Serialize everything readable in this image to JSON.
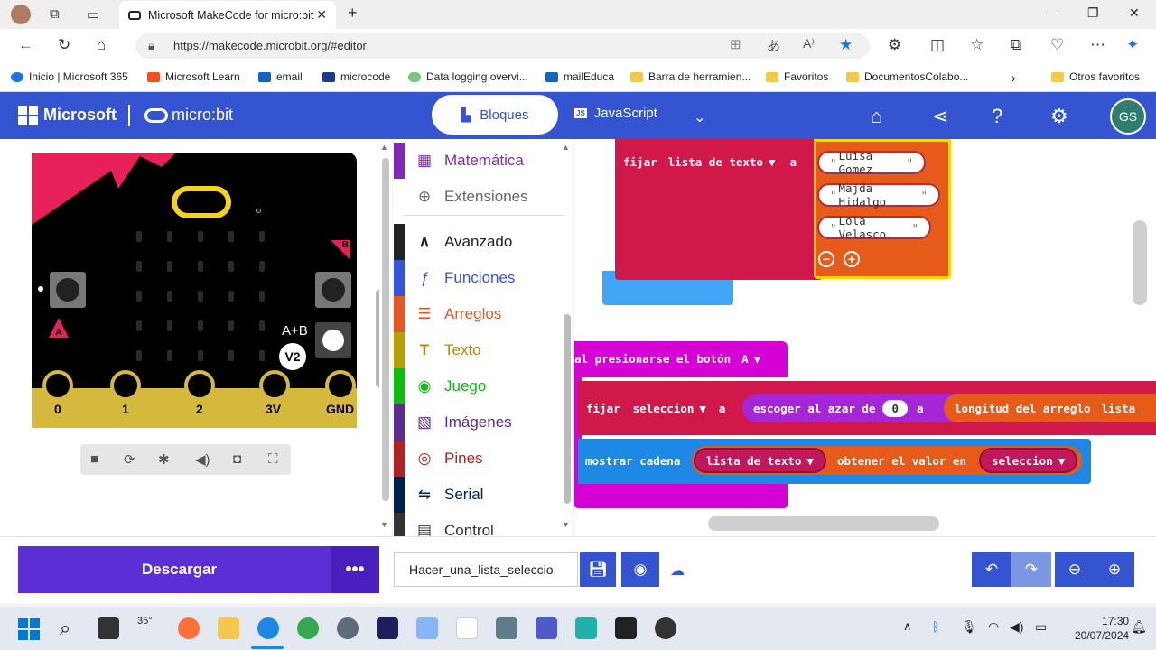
{
  "browser": {
    "tab_title": "Microsoft MakeCode for micro:bit",
    "url": "https://makecode.microbit.org/#editor",
    "bookmarks": [
      "Inicio | Microsoft 365",
      "Microsoft Learn",
      "email",
      "microcode",
      "Data logging overvi...",
      "mailEduca",
      "Barra de herramien...",
      "Favoritos",
      "DocumentosColabo...",
      "Otros favoritos"
    ]
  },
  "header": {
    "brand": "Microsoft",
    "product": "micro:bit",
    "blocks_tab": "Bloques",
    "js_tab": "JavaScript",
    "js_badge": "JS",
    "avatar_initials": "GS"
  },
  "simulator": {
    "pins": [
      "0",
      "1",
      "2",
      "3V",
      "GND"
    ],
    "ab_label": "A+B",
    "version_badge": "V2",
    "button_a": "A",
    "button_b": "B"
  },
  "toolbox": {
    "items": [
      {
        "label": "Matemática",
        "icon": "▦",
        "color": "#7b2bb8"
      },
      {
        "label": "Extensiones",
        "icon": "⊕",
        "color": "#666666"
      },
      {
        "label": "Avanzado",
        "icon": "∧",
        "color": "#222222"
      },
      {
        "label": "Funciones",
        "icon": "ƒ",
        "color": "#3455db"
      },
      {
        "label": "Arreglos",
        "icon": "☰",
        "color": "#e65722"
      },
      {
        "label": "Texto",
        "icon": "T",
        "color": "#b8860b"
      },
      {
        "label": "Juego",
        "icon": "◉",
        "color": "#0fbc11"
      },
      {
        "label": "Imágenes",
        "icon": "▧",
        "color": "#5c2d91"
      },
      {
        "label": "Pines",
        "icon": "◎",
        "color": "#b22222"
      },
      {
        "label": "Serial",
        "icon": "⇋",
        "color": "#002050"
      },
      {
        "label": "Control",
        "icon": "▤",
        "color": "#333333"
      }
    ]
  },
  "workspace": {
    "set_text_list": {
      "fijar": "fijar",
      "variable": "lista de texto",
      "a": "a"
    },
    "names": [
      "Luisa Gomez",
      "Majda Hidalgo",
      "Lola Velasco"
    ],
    "button_event": {
      "label": "al presionarse el botón",
      "button": "A"
    },
    "set_selection": {
      "fijar": "fijar",
      "variable": "seleccion",
      "a": "a",
      "pick_random": "escoger al azar de",
      "from": "0",
      "to_word": "a",
      "length_label": "longitud del arreglo",
      "list": "lista"
    },
    "show_string": {
      "label": "mostrar cadena",
      "list": "lista de texto",
      "get": "obtener el valor en",
      "index": "seleccion"
    }
  },
  "bottom": {
    "download": "Descargar",
    "project_name": "Hacer_una_lista_seleccio"
  },
  "taskbar": {
    "temperature": "35°",
    "time": "17:30",
    "date": "20/07/2024"
  }
}
